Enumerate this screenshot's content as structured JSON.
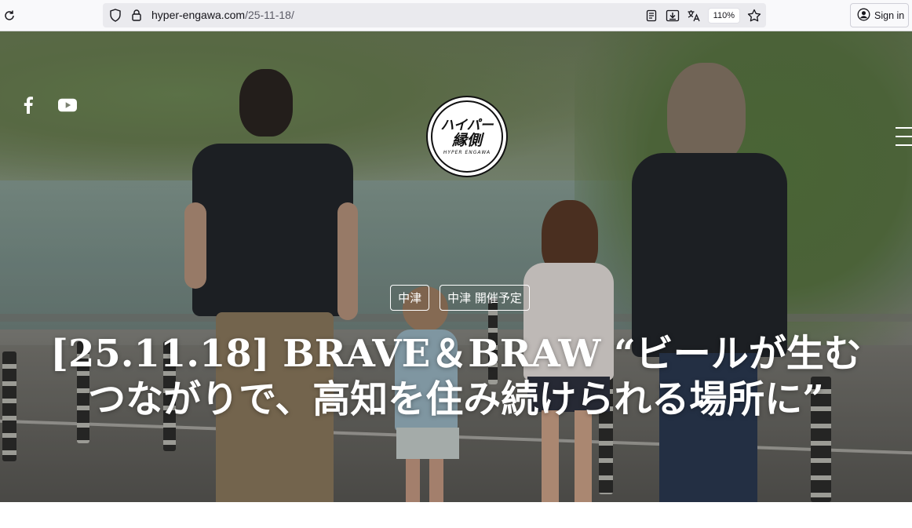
{
  "browser": {
    "url_host": "hyper-engawa.com",
    "url_path": "/25-11-18/",
    "zoom": "110%",
    "sign_in": "Sign in"
  },
  "hero": {
    "logo": {
      "jp_line1": "ハイパー",
      "jp_line2": "縁側",
      "en": "HYPER ENGAWA"
    },
    "tags": [
      "中津",
      "中津 開催予定"
    ],
    "title_line1": "[25.11.18] BRAVE＆BRAW “ビールが生む",
    "title_line2": "つながりで、高知を住み続けられる場所に”"
  },
  "icons": {
    "reload": "reload-icon",
    "shield": "shield-icon",
    "lock": "lock-icon",
    "reader": "reader-view-icon",
    "download": "download-icon",
    "translate": "translate-icon",
    "bookmark": "bookmark-star-icon",
    "account": "account-icon",
    "facebook": "facebook-icon",
    "youtube": "youtube-icon",
    "menu": "hamburger-menu-icon"
  }
}
